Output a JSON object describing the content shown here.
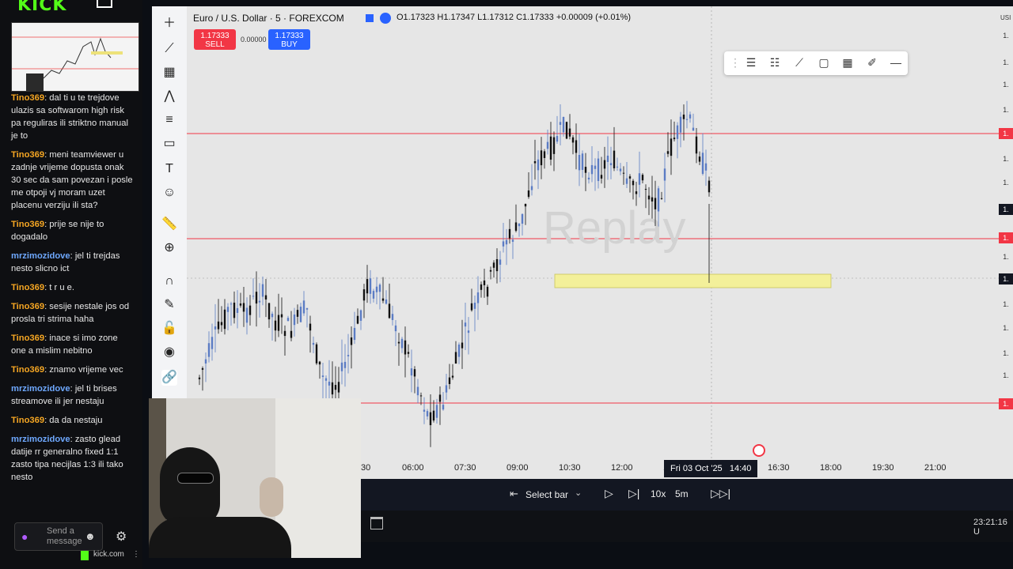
{
  "stream": {
    "brand": "KICK",
    "chat": [
      {
        "user": "Tino369",
        "color": "#f5a623",
        "text": "dal ti u te trejdove ulazis sa softwarom high risk pa reguliras ili striktno manual je to"
      },
      {
        "user": "Tino369",
        "color": "#f5a623",
        "text": "meni teamviewer u zadnje vrijeme dopusta onak 30 sec da sam povezan i posle me otpoji vj moram uzet placenu verziju ili sta?"
      },
      {
        "user": "Tino369",
        "color": "#f5a623",
        "text": "prije se nije to dogadalo"
      },
      {
        "user": "mrzimozidove",
        "color": "#6ea8fe",
        "text": "jel ti trejdas nesto slicno ict"
      },
      {
        "user": "Tino369",
        "color": "#f5a623",
        "text": "t r u e."
      },
      {
        "user": "Tino369",
        "color": "#f5a623",
        "text": "sesije nestale jos od prosla tri strima haha"
      },
      {
        "user": "Tino369",
        "color": "#f5a623",
        "text": "inace si imo zone one a mislim nebitno"
      },
      {
        "user": "Tino369",
        "color": "#f5a623",
        "text": "znamo vrijeme vec"
      },
      {
        "user": "mrzimozidove",
        "color": "#6ea8fe",
        "text": "jel ti brises streamove ili jer nestaju"
      },
      {
        "user": "Tino369",
        "color": "#f5a623",
        "text": "da da nestaju"
      },
      {
        "user": "mrzimozidove",
        "color": "#6ea8fe",
        "text": "zasto glead datije rr generalno fixed 1:1 zasto tipa necijlas 1:3 ili tako nesto"
      }
    ],
    "send_placeholder": "Send a message",
    "footer": "kick.com"
  },
  "chart": {
    "title": "Euro / U.S. Dollar · 5 · FOREXCOM",
    "ohlc": "O1.17323 H1.17347 L1.17312 C1.17333 +0.00009 (+0.01%)",
    "sell_price": "1.17333",
    "sell_label": "SELL",
    "spread": "0.00000",
    "buy_price": "1.17333",
    "buy_label": "BUY",
    "watermark": "Replay",
    "time_labels": [
      "30",
      "06:00",
      "07:30",
      "09:00",
      "10:30",
      "12:00",
      "1",
      "16:30",
      "18:00",
      "19:30",
      "21:00"
    ],
    "crosshair_time": "Fri 03 Oct '25",
    "crosshair_clock": "14:40",
    "price_labels": [
      "1.",
      "1.",
      "1.",
      "1.",
      "1.",
      "1.",
      "1.",
      "1.",
      "1.",
      "1.",
      "1.",
      "1.",
      "1.",
      "1.",
      "1.",
      "1."
    ],
    "axis_top": "USI",
    "colors": {
      "sell": "#f23645",
      "buy": "#2962ff",
      "up": "#5b7cc4",
      "down": "#111111",
      "level": "#f23645",
      "zone": "#f3f09a"
    }
  },
  "replay": {
    "select_bar": "Select bar",
    "speed": "10x",
    "interval": "5m"
  },
  "bottom": {
    "clock": "23:21:16 U"
  }
}
